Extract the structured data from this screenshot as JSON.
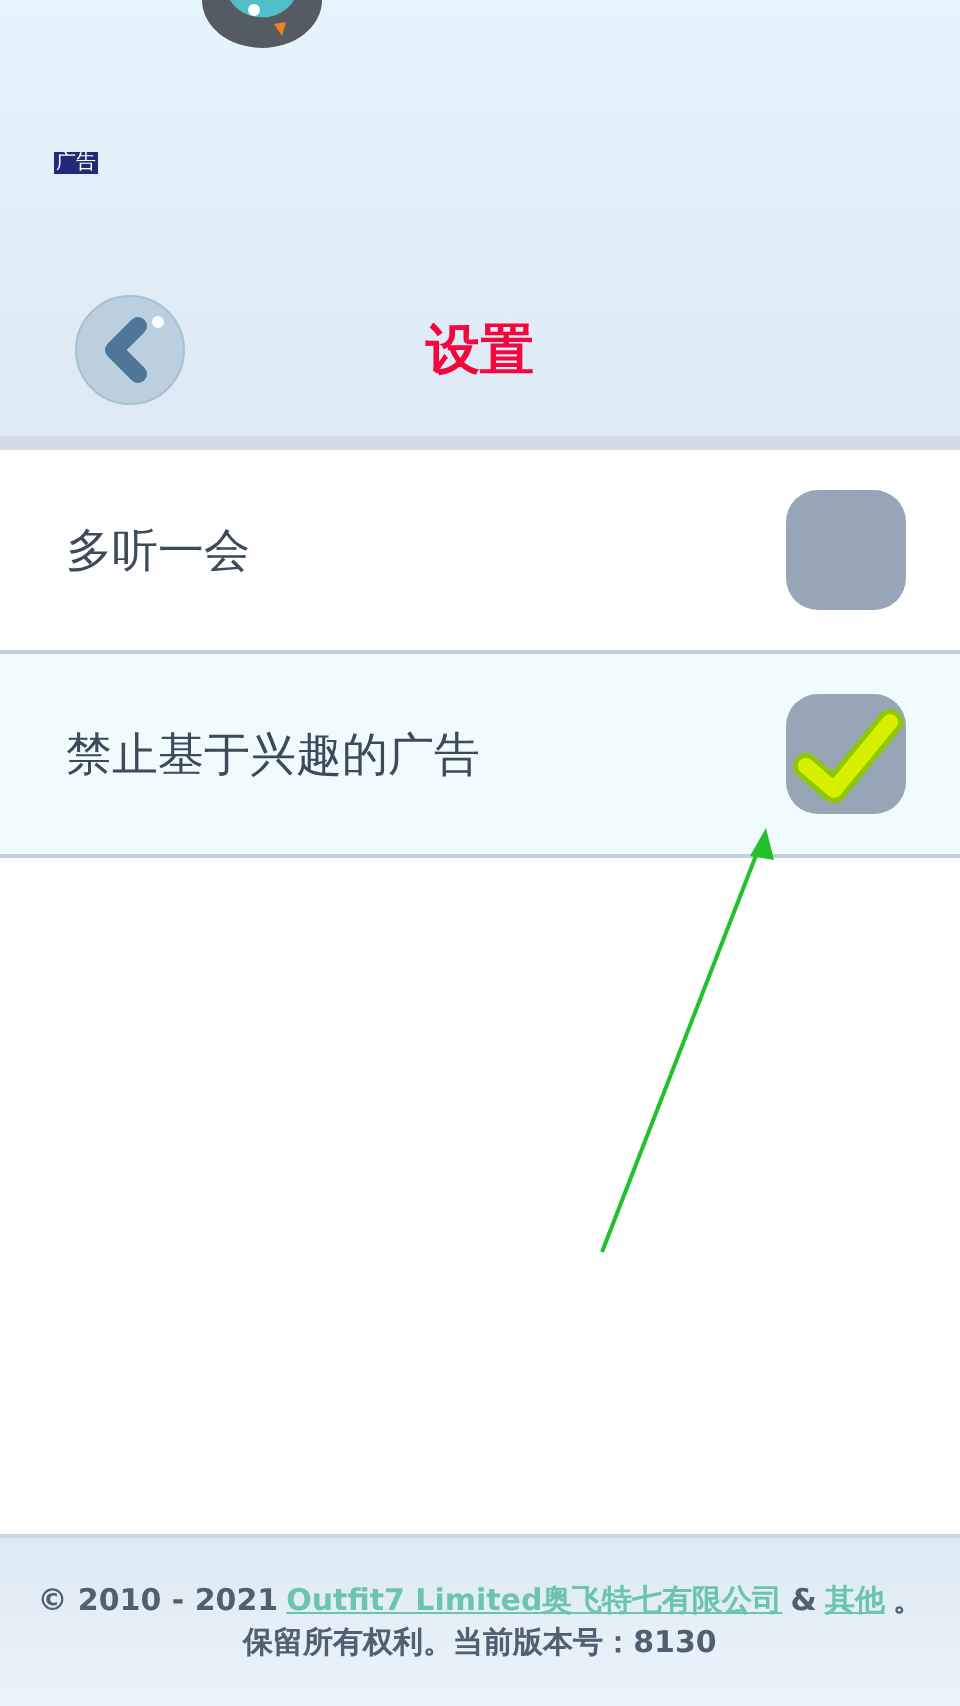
{
  "header": {
    "ad_badge": "广告",
    "title": "设置"
  },
  "settings": [
    {
      "label": "多听一会",
      "checked": false,
      "highlighted": false
    },
    {
      "label": "禁止基于兴趣的广告",
      "checked": true,
      "highlighted": true
    }
  ],
  "footer": {
    "copyright": "© 2010 - 2021",
    "company_link": " Outfit7 Limited奥飞特七有限公司",
    "ampersand": "&",
    "others_link": "其他",
    "period": "。",
    "rights": "保留所有权利。当前版本号：8130"
  }
}
